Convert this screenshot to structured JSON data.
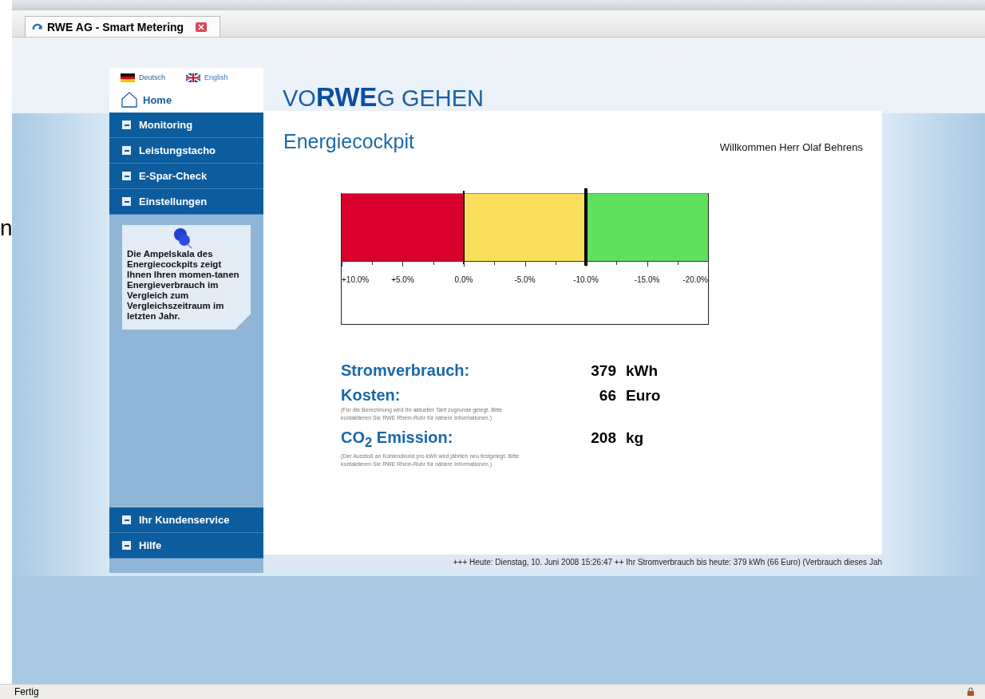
{
  "browser": {
    "tab_title": "RWE AG - Smart Metering",
    "edge_text": "n"
  },
  "languages": [
    {
      "label": "Deutsch",
      "kind": "de",
      "selected": true
    },
    {
      "label": "English",
      "kind": "gb",
      "selected": false
    }
  ],
  "home": {
    "label": "Home"
  },
  "nav": [
    {
      "label": "Monitoring"
    },
    {
      "label": "Leistungstacho"
    },
    {
      "label": "E-Spar-Check"
    },
    {
      "label": "Einstellungen"
    }
  ],
  "info_note": "Die Ampelskala des Energiecockpits zeigt Ihnen Ihren momen-tanen Energieverbrauch im Vergleich zum Vergleichszeitraum im letzten Jahr.",
  "nav_bottom": [
    {
      "label": "Ihr Kundenservice"
    },
    {
      "label": "Hilfe"
    }
  ],
  "logo": "VO**RWE**G GEHEN",
  "page_title": "Energiecockpit",
  "welcome": "Willkommen Herr Olaf Behrens",
  "gauge": {
    "level": 0.667,
    "zones": [
      {
        "color": "#d9002e"
      },
      {
        "color": "#f9df5c"
      },
      {
        "color": "#5fe05f"
      }
    ],
    "tick_labels": [
      "+10.0%",
      "+5.0%",
      "0.0%",
      "-5.0%",
      "-10.0%",
      "-15.0%",
      "-20.0%"
    ]
  },
  "metrics": [
    {
      "label": "Stromverbrauch:",
      "value": "379",
      "unit": "kWh"
    },
    {
      "label": "Kosten:",
      "value": "66",
      "unit": "Euro",
      "note": "(Für die Berechnung wird Ihr aktueller Tarif zugrunde gelegt. Bitte kontaktieren Sie RWE Rhein-Ruhr für nähere Informationen.)"
    },
    {
      "label": "CO$_{2}$ Emission:",
      "value": "208",
      "unit": "kg",
      "note": "(Der Ausstoß an Kohlendioxid pro kWh wird jährlich neu festgelegt. Bitte kontaktieren Sie RWE Rhein-Ruhr für nähere Informationen.)"
    }
  ],
  "ticker": "+++ Heute: Dienstag, 10. Juni 2008 15:26:47 ++ Ihr Stromverbrauch bis heute: 379 kWh (66 Euro) (Verbrauch dieses Jah",
  "status_bar": {
    "text": "Fertig"
  }
}
